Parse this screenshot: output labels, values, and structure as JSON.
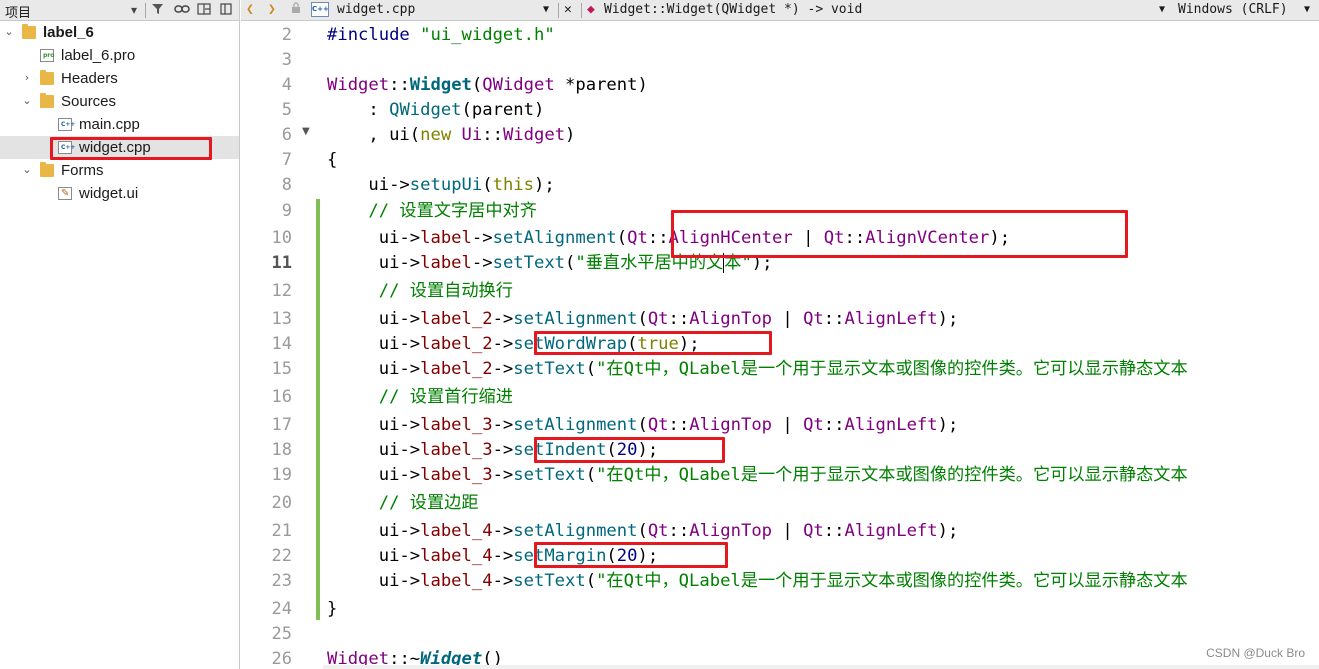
{
  "project_pane": {
    "title": "项目",
    "tree": [
      {
        "label": "label_6",
        "type": "project",
        "expanded": true
      },
      {
        "label": "label_6.pro",
        "type": "pro-file"
      },
      {
        "label": "Headers",
        "type": "folder",
        "expanded": false
      },
      {
        "label": "Sources",
        "type": "folder",
        "expanded": true
      },
      {
        "label": "main.cpp",
        "type": "cpp-file"
      },
      {
        "label": "widget.cpp",
        "type": "cpp-file",
        "selected": true
      },
      {
        "label": "Forms",
        "type": "folder",
        "expanded": true
      },
      {
        "label": "widget.ui",
        "type": "ui-file"
      }
    ]
  },
  "editor_toolbar": {
    "file_name": "widget.cpp",
    "symbol": "Widget::Widget(QWidget *) -> void",
    "line_ending": "Windows (CRLF)",
    "cpp_badge": "C++"
  },
  "code": {
    "line_numbers": [
      "2",
      "3",
      "4",
      "5",
      "6",
      "7",
      "8",
      "9",
      "10",
      "11",
      "12",
      "13",
      "14",
      "15",
      "16",
      "17",
      "18",
      "19",
      "20",
      "21",
      "22",
      "23",
      "24",
      "25",
      "26"
    ],
    "current_line": "11",
    "lines": {
      "l2": [
        "#include ",
        "\"ui_widget.h\""
      ],
      "l4": [
        "Widget",
        "::",
        "Widget",
        "(",
        "QWidget",
        " *parent)"
      ],
      "l5": [
        "    : ",
        "QWidget",
        "(parent)"
      ],
      "l6": [
        "    , ui(",
        "new",
        " ",
        "Ui",
        "::",
        "Widget",
        ")"
      ],
      "l7": "{",
      "l8": [
        "    ui->",
        "setupUi",
        "(",
        "this",
        ");"
      ],
      "l9": "    // 设置文字居中对齐",
      "l10": [
        "     ui->",
        "label",
        "->",
        "setAlignment",
        "(",
        "Qt",
        "::",
        "AlignHCenter",
        " | ",
        "Qt",
        "::",
        "AlignVCenter",
        ");"
      ],
      "l11": [
        "     ui->",
        "label",
        "->",
        "setText",
        "(",
        "\"垂直水平居中的文",
        "本\"",
        ");"
      ],
      "l12": "     // 设置自动换行",
      "l13": [
        "     ui->",
        "label_2",
        "->",
        "setAlignment",
        "(",
        "Qt",
        "::",
        "AlignTop",
        " | ",
        "Qt",
        "::",
        "AlignLeft",
        ");"
      ],
      "l14": [
        "     ui->",
        "label_2",
        "->",
        "setWordWrap",
        "(",
        "true",
        ");"
      ],
      "l15": [
        "     ui->",
        "label_2",
        "->",
        "setText",
        "(",
        "\"在Qt中，QLabel是一个用于显示文本或图像的控件类。它可以显示静态文本"
      ],
      "l16": "     // 设置首行缩进",
      "l17": [
        "     ui->",
        "label_3",
        "->",
        "setAlignment",
        "(",
        "Qt",
        "::",
        "AlignTop",
        " | ",
        "Qt",
        "::",
        "AlignLeft",
        ");"
      ],
      "l18": [
        "     ui->",
        "label_3",
        "->",
        "setIndent",
        "(",
        "20",
        ");"
      ],
      "l19": [
        "     ui->",
        "label_3",
        "->",
        "setText",
        "(",
        "\"在Qt中，QLabel是一个用于显示文本或图像的控件类。它可以显示静态文本"
      ],
      "l20": "     // 设置边距",
      "l21": [
        "     ui->",
        "label_4",
        "->",
        "setAlignment",
        "(",
        "Qt",
        "::",
        "AlignTop",
        " | ",
        "Qt",
        "::",
        "AlignLeft",
        ");"
      ],
      "l22": [
        "     ui->",
        "label_4",
        "->",
        "setMargin",
        "(",
        "20",
        ");"
      ],
      "l23": [
        "     ui->",
        "label_4",
        "->",
        "setText",
        "(",
        "\"在Qt中，QLabel是一个用于显示文本或图像的控件类。它可以显示静态文本"
      ],
      "l24": "}",
      "l26": [
        "Widget",
        "::~",
        "Widget",
        "()"
      ]
    }
  },
  "watermark": "CSDN @Duck Bro",
  "colors": {
    "highlight_box": "#e5171f",
    "keyword": "#808000",
    "string": "#008000",
    "class": "#800080",
    "function": "#00677c",
    "member": "#800000"
  }
}
